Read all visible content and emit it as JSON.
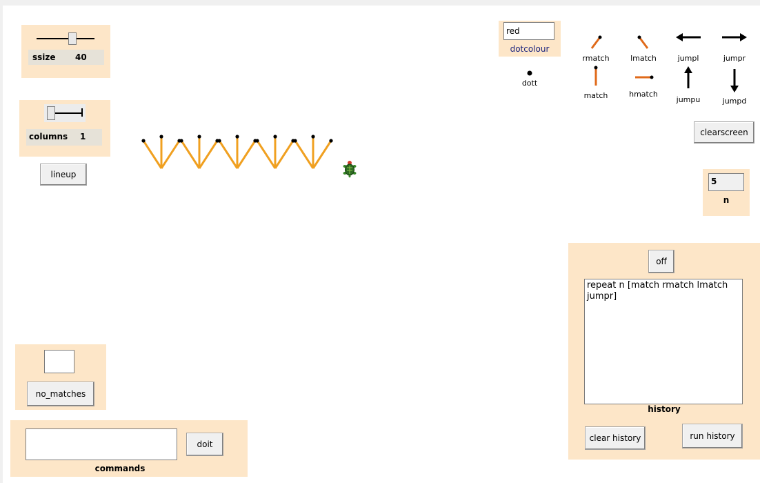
{
  "ssize": {
    "label": "ssize",
    "value": "40",
    "slider_level": 0.6
  },
  "columns": {
    "label": "columns",
    "value": "1",
    "slider_level": 0.0
  },
  "lineup_label": "lineup",
  "dotcolour": {
    "value": "red",
    "label": "dotcolour"
  },
  "tools": {
    "dott": "dott",
    "rmatch": "rmatch",
    "lmatch": "lmatch",
    "jumpl": "jumpl",
    "jumpr": "jumpr",
    "match": "match",
    "hmatch": "hmatch",
    "jumpu": "jumpu",
    "jumpd": "jumpd"
  },
  "clearscreen_label": "clearscreen",
  "n": {
    "value": "5",
    "label": "n"
  },
  "history": {
    "toggle_label": "off",
    "text": "repeat n [match rmatch lmatch jumpr]",
    "label": "history",
    "clear_label": "clear history",
    "run_label": "run history"
  },
  "no_matches": {
    "value": "",
    "button_label": "no_matches"
  },
  "commands": {
    "value": "",
    "button_label": "doit",
    "label": "commands"
  },
  "colors": {
    "panel": "#fde6c8",
    "match_stick": "#f0a020",
    "match_head": "#000000",
    "orange_tool": "#e06a1a"
  }
}
